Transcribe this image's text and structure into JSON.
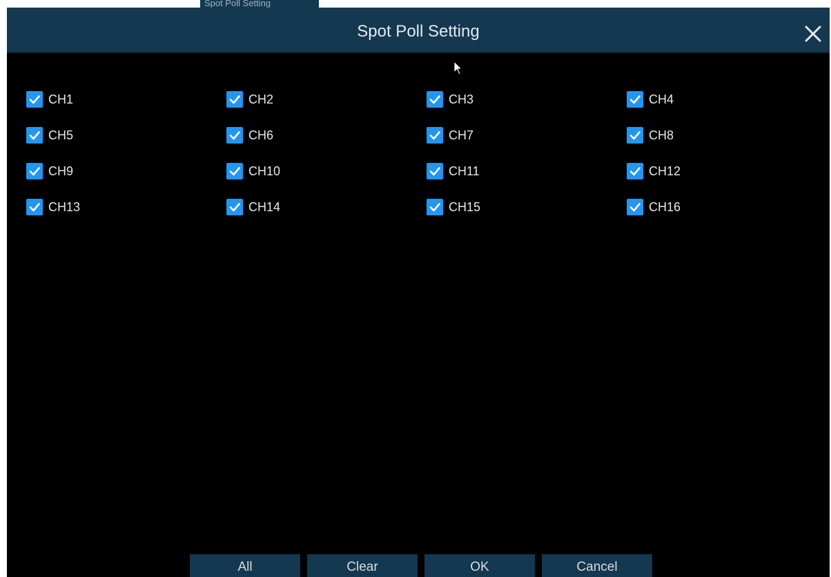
{
  "background_tab": {
    "label": "Spot Poll Setting"
  },
  "dialog": {
    "title": "Spot Poll Setting",
    "close_icon": "close-icon",
    "accent_color": "#2196f3",
    "header_color": "#13384f"
  },
  "channels": [
    {
      "label": "CH1",
      "checked": true
    },
    {
      "label": "CH2",
      "checked": true
    },
    {
      "label": "CH3",
      "checked": true
    },
    {
      "label": "CH4",
      "checked": true
    },
    {
      "label": "CH5",
      "checked": true
    },
    {
      "label": "CH6",
      "checked": true
    },
    {
      "label": "CH7",
      "checked": true
    },
    {
      "label": "CH8",
      "checked": true
    },
    {
      "label": "CH9",
      "checked": true
    },
    {
      "label": "CH10",
      "checked": true
    },
    {
      "label": "CH11",
      "checked": true
    },
    {
      "label": "CH12",
      "checked": true
    },
    {
      "label": "CH13",
      "checked": true
    },
    {
      "label": "CH14",
      "checked": true
    },
    {
      "label": "CH15",
      "checked": true
    },
    {
      "label": "CH16",
      "checked": true
    }
  ],
  "footer": {
    "all_label": "All",
    "clear_label": "Clear",
    "ok_label": "OK",
    "cancel_label": "Cancel"
  }
}
